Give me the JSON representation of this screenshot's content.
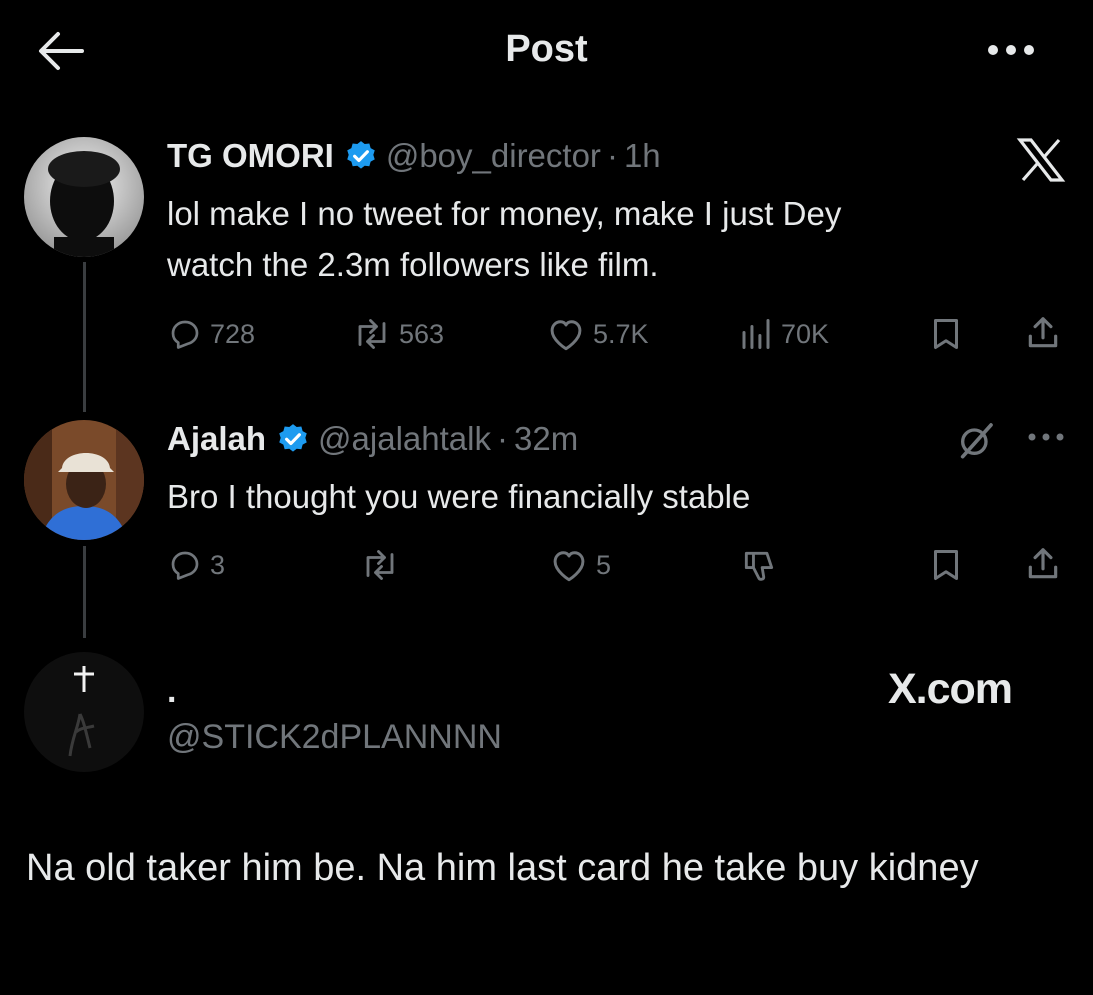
{
  "header": {
    "title": "Post"
  },
  "tweet1": {
    "name": "TG OMORI",
    "handle": "@boy_director",
    "sep": "·",
    "time": "1h",
    "text_line1": "lol make I no tweet for money, make I just Dey",
    "text_line2": "watch the 2.3m followers like film.",
    "replies": "728",
    "retweets": "563",
    "likes": "5.7K",
    "views": "70K"
  },
  "tweet2": {
    "name": "Ajalah",
    "handle": "@ajalahtalk",
    "sep": "·",
    "time": "32m",
    "text": "Bro I thought you were financially stable",
    "replies": "3",
    "likes": "5"
  },
  "quote": {
    "name": ".",
    "handle": "@STICK2dPLANNNN",
    "watermark": "X.com",
    "caption": "Na old taker him be. Na him last card he take buy kidney"
  },
  "colors": {
    "background": "#000000",
    "text": "#e7e9ea",
    "muted": "#71767b",
    "verified": "#1d9bf0"
  },
  "icons": [
    "back-arrow-icon",
    "more-icon",
    "verified-icon",
    "x-logo-icon",
    "reply-icon",
    "retweet-icon",
    "like-icon",
    "views-icon",
    "bookmark-icon",
    "share-icon",
    "grok-icon",
    "downvote-icon"
  ]
}
